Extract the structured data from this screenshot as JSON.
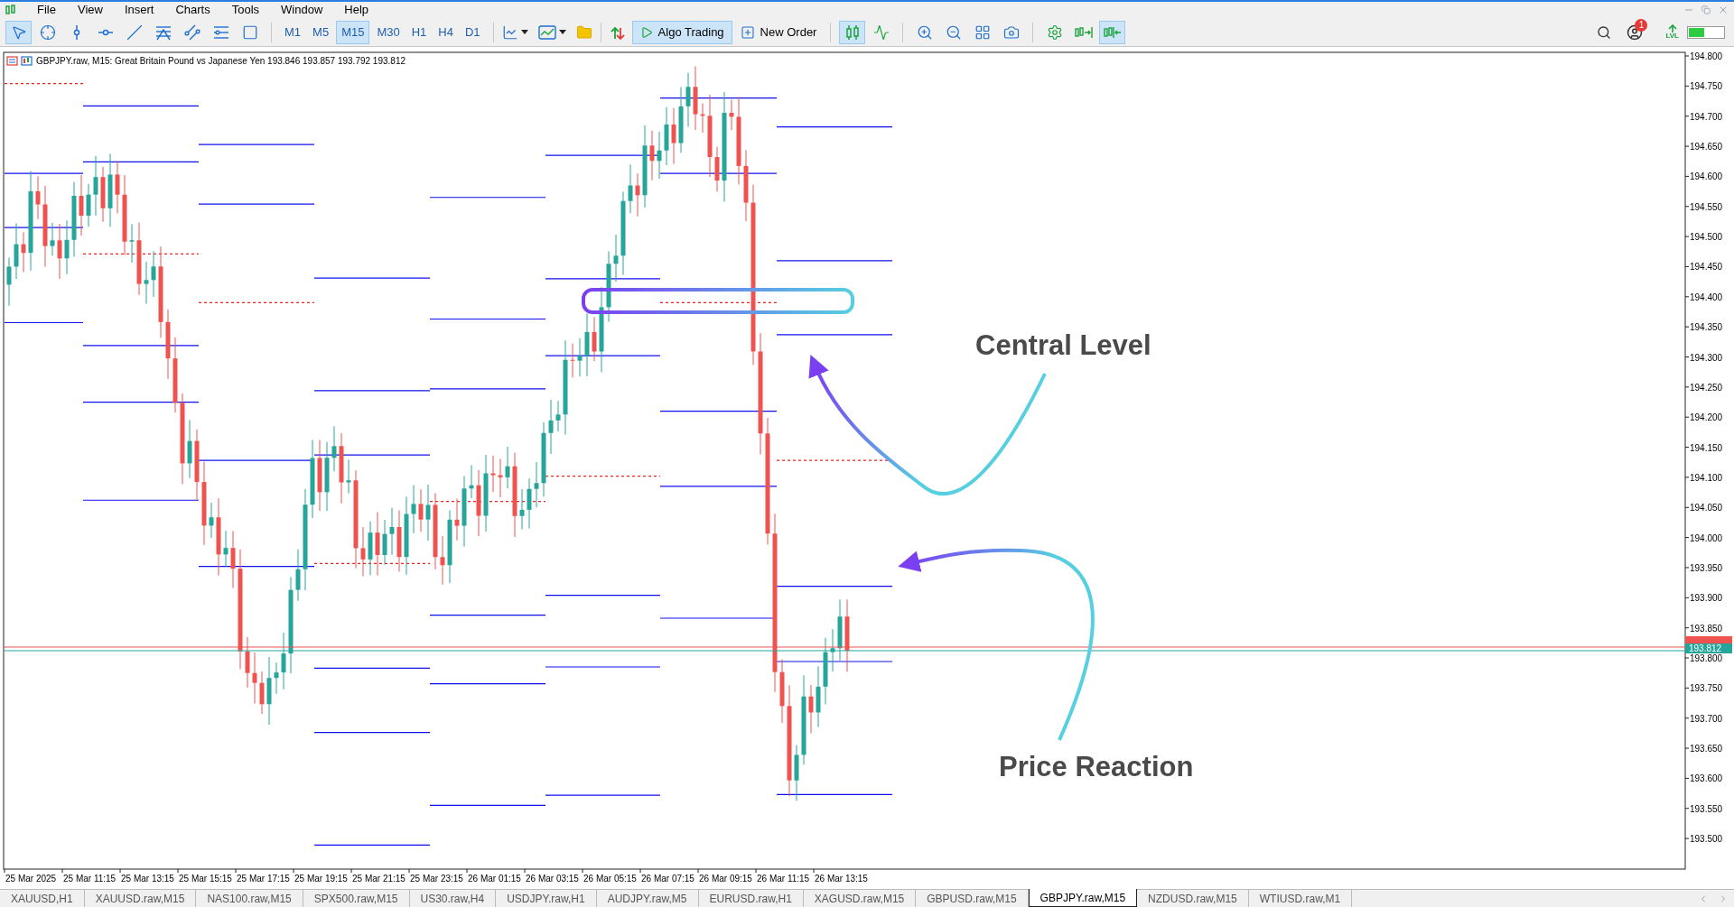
{
  "menu": [
    "File",
    "View",
    "Insert",
    "Charts",
    "Tools",
    "Window",
    "Help"
  ],
  "drawing_tools": [
    {
      "kind": "cursor",
      "selected": true
    },
    {
      "kind": "crosshair",
      "selected": false
    },
    {
      "kind": "vline",
      "selected": false
    },
    {
      "kind": "hline",
      "selected": false
    },
    {
      "kind": "trend",
      "selected": false
    },
    {
      "kind": "fibo",
      "selected": false
    },
    {
      "kind": "channel",
      "selected": false
    },
    {
      "kind": "lines",
      "selected": false
    },
    {
      "kind": "rect",
      "selected": false
    }
  ],
  "timeframes": [
    {
      "label": "M1",
      "selected": false
    },
    {
      "label": "M5",
      "selected": false
    },
    {
      "label": "M15",
      "selected": true
    },
    {
      "label": "M30",
      "selected": false
    },
    {
      "label": "H1",
      "selected": false
    },
    {
      "label": "H4",
      "selected": false
    },
    {
      "label": "D1",
      "selected": false
    }
  ],
  "algo_trading": {
    "label": "Algo Trading",
    "on": true
  },
  "new_order": {
    "label": "New Order"
  },
  "view_tools": [
    {
      "kind": "candles",
      "on": true
    },
    {
      "kind": "indicators",
      "on": false
    },
    {
      "kind": "zoom_in",
      "on": false
    },
    {
      "kind": "zoom_out",
      "on": false
    },
    {
      "kind": "tile",
      "on": false
    },
    {
      "kind": "screenshot",
      "on": false
    },
    {
      "kind": "settings",
      "on": false
    },
    {
      "kind": "autoscroll",
      "on": false
    },
    {
      "kind": "shift",
      "on": true
    }
  ],
  "account": {
    "notifications": "1",
    "level_label": "LVL"
  },
  "chart": {
    "header": "GBPJPY.raw, M15:  Great Britain Pound vs Japanese Yen  193.846 193.857 193.792 193.812",
    "price_ticks": [
      "194.800",
      "194.750",
      "194.700",
      "194.650",
      "194.600",
      "194.550",
      "194.500",
      "194.450",
      "194.400",
      "194.350",
      "194.300",
      "194.250",
      "194.200",
      "194.150",
      "194.100",
      "194.050",
      "194.000",
      "193.950",
      "193.900",
      "193.850",
      "193.800",
      "193.750",
      "193.700",
      "193.650",
      "193.600",
      "193.550",
      "193.500"
    ],
    "time_ticks": [
      "25 Mar 2025",
      "25 Mar 11:15",
      "25 Mar 13:15",
      "25 Mar 15:15",
      "25 Mar 17:15",
      "25 Mar 19:15",
      "25 Mar 21:15",
      "25 Mar 23:15",
      "26 Mar 01:15",
      "26 Mar 03:15",
      "26 Mar 05:15",
      "26 Mar 07:15",
      "26 Mar 09:15",
      "26 Mar 11:15",
      "26 Mar 13:15"
    ],
    "bid_price": "193.812",
    "annotations": [
      {
        "kind": "label",
        "text": "Central Level"
      },
      {
        "kind": "label",
        "text": "Price Reaction"
      }
    ]
  },
  "tabs": [
    {
      "label": "XAUUSD,H1",
      "selected": false
    },
    {
      "label": "XAUUSD.raw,M15",
      "selected": false
    },
    {
      "label": "NAS100.raw,M15",
      "selected": false
    },
    {
      "label": "SPX500.raw,M15",
      "selected": false
    },
    {
      "label": "US30.raw,H4",
      "selected": false
    },
    {
      "label": "USDJPY.raw,H1",
      "selected": false
    },
    {
      "label": "AUDJPY.raw,M5",
      "selected": false
    },
    {
      "label": "EURUSD.raw,H1",
      "selected": false
    },
    {
      "label": "XAGUSD.raw,M15",
      "selected": false
    },
    {
      "label": "GBPUSD.raw,M15",
      "selected": false
    },
    {
      "label": "GBPJPY.raw,M15",
      "selected": true
    },
    {
      "label": "NZDUSD.raw,M15",
      "selected": false
    },
    {
      "label": "WTIUSD.raw,M1",
      "selected": false
    }
  ]
}
